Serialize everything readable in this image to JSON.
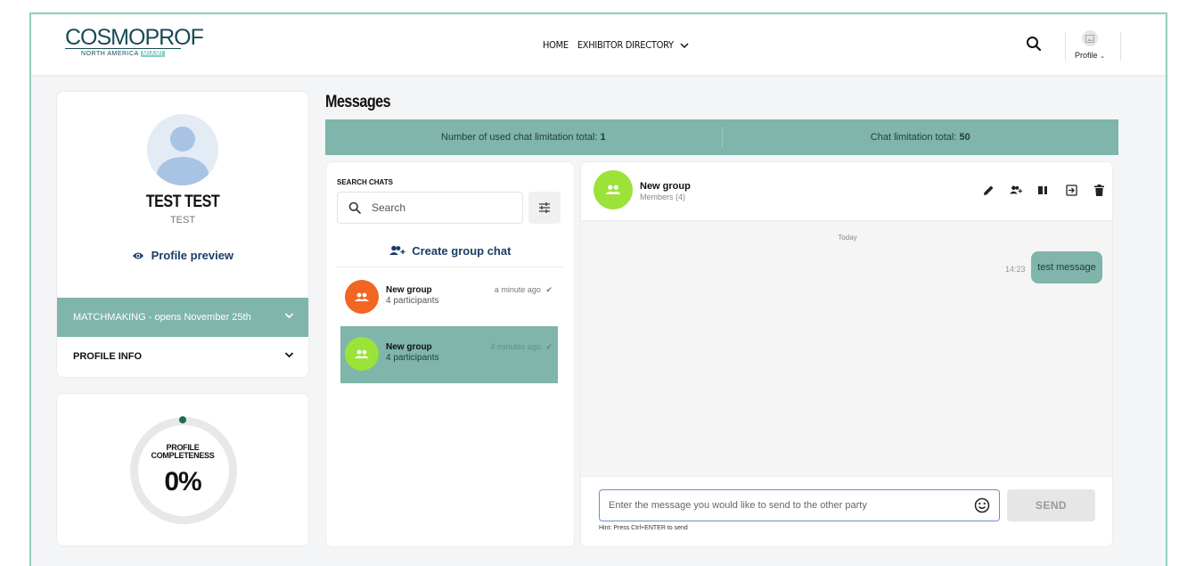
{
  "colors": {
    "accent": "#7fb5aa",
    "frame_border": "#8ecfc3",
    "link_blue": "#1a3c66",
    "orange_avatar": "#f26522",
    "green_avatar": "#9be239"
  },
  "header": {
    "logo_main": "COSMOPROF",
    "logo_sub": "NORTH AMERICA",
    "logo_miami": "MIAMI",
    "nav": {
      "home": "HOME",
      "exhibitor_directory": "EXHIBITOR DIRECTORY"
    },
    "profile_label": "Profile"
  },
  "profile_card": {
    "name": "TEST TEST",
    "subtitle": "TEST",
    "preview_link": "Profile preview",
    "matchmaking": "MATCHMAKING - opens November 25th",
    "profile_info": "PROFILE INFO"
  },
  "completeness": {
    "label_line1": "PROFILE",
    "label_line2": "COMPLETENESS",
    "value": "0%",
    "fraction": 0
  },
  "messages": {
    "title": "Messages",
    "used_limit_label": "Number of used chat limitation total:",
    "used_limit_value": "1",
    "total_limit_label": "Chat limitation total:",
    "total_limit_value": "50"
  },
  "chat_list": {
    "search_label": "SEARCH CHATS",
    "search_placeholder": "Search",
    "create_group": "Create group chat",
    "items": [
      {
        "name": "New group",
        "sub": "4 participants",
        "time": "a minute ago",
        "avatar_color": "#f26522",
        "selected": false
      },
      {
        "name": "New group",
        "sub": "4 participants",
        "time": "4 minutes ago",
        "avatar_color": "#9be239",
        "selected": true
      }
    ]
  },
  "conversation": {
    "name": "New group",
    "members": "Members (4)",
    "day_label": "Today",
    "messages": [
      {
        "time": "14:23",
        "text": "test message"
      }
    ],
    "input_placeholder": "Enter the message you would like to send to the other party",
    "send_label": "SEND",
    "hint": "Hint: Press Ctrl+ENTER to send",
    "actions": [
      "edit-icon",
      "add-member-icon",
      "panel-icon",
      "exit-icon",
      "delete-icon"
    ]
  }
}
